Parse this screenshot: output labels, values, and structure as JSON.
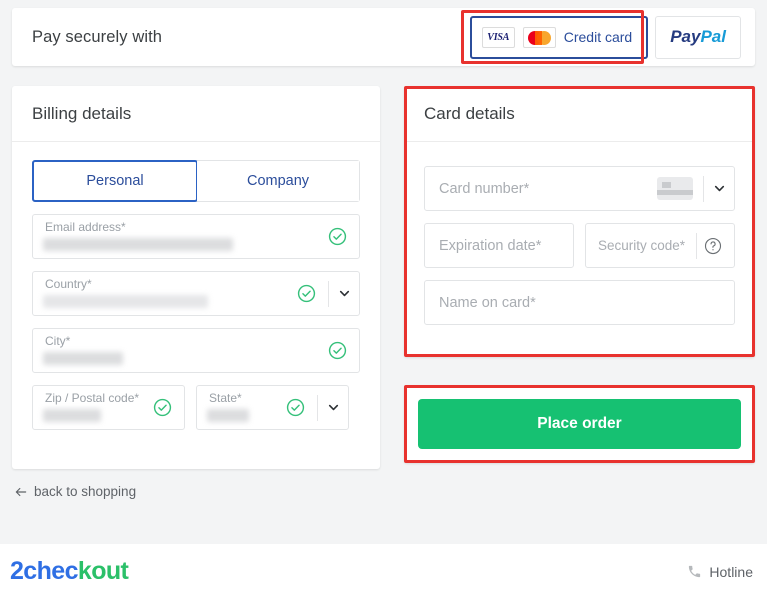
{
  "paybar": {
    "title": "Pay securely with",
    "methods": [
      {
        "id": "credit-card",
        "label": "Credit card",
        "selected": true,
        "brands": [
          "VISA",
          "mastercard"
        ]
      },
      {
        "id": "paypal",
        "label_part1": "Pay",
        "label_part2": "Pal",
        "selected": false
      }
    ]
  },
  "billing": {
    "heading": "Billing details",
    "tabs": [
      {
        "label": "Personal",
        "active": true
      },
      {
        "label": "Company",
        "active": false
      }
    ],
    "fields": [
      {
        "name": "email",
        "label": "Email address*",
        "value_redacted": true,
        "valid": true,
        "has_dropdown": false
      },
      {
        "name": "country",
        "label": "Country*",
        "value_redacted": true,
        "valid": true,
        "has_dropdown": true
      },
      {
        "name": "city",
        "label": "City*",
        "value_redacted": true,
        "valid": true,
        "has_dropdown": false
      },
      {
        "name": "zip",
        "label": "Zip / Postal code*",
        "value_redacted": true,
        "valid": true,
        "has_dropdown": false
      },
      {
        "name": "state",
        "label": "State*",
        "value_redacted": true,
        "valid": true,
        "has_dropdown": true
      }
    ]
  },
  "card_details": {
    "heading": "Card details",
    "fields": [
      {
        "name": "card-number",
        "placeholder": "Card number*",
        "icon": "credit-card-icon",
        "has_dropdown": true
      },
      {
        "name": "expiration-date",
        "placeholder": "Expiration date*"
      },
      {
        "name": "security-code",
        "placeholder": "Security code*",
        "icon": "help-circle-icon"
      },
      {
        "name": "name-on-card",
        "placeholder": "Name on card*"
      }
    ]
  },
  "place_order": {
    "label": "Place order",
    "color": "#16c172"
  },
  "back_link": {
    "label": "back to shopping",
    "icon": "arrow-left-icon"
  },
  "footer": {
    "logo_part1": "2chec",
    "logo_part2": "kout",
    "logo_color1": "#2f6fe4",
    "logo_color2": "#2bc069",
    "hotline_label": "Hotline",
    "hotline_icon": "phone-icon"
  },
  "annotations": {
    "highlight_color": "#e8322e",
    "boxes": [
      "credit-card-method",
      "card-details-panel",
      "place-order-panel"
    ]
  }
}
